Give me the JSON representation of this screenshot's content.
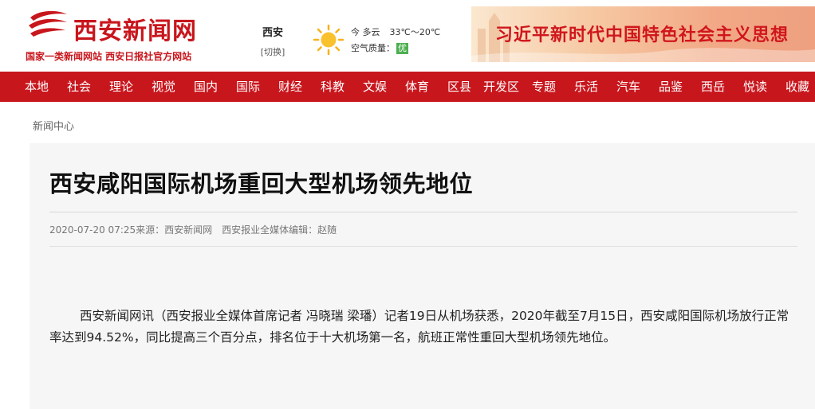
{
  "header": {
    "logo_text": "西安新闻网",
    "logo_tagline": "国家一类新闻网站 西安日报社官方网站",
    "city": "西安",
    "city_switch": "[切换]",
    "weather": {
      "icon": "sun-icon",
      "condition": "今 多云",
      "temperature": "33℃～20℃",
      "aqi_label": "空气质量：",
      "aqi_value": "优"
    },
    "banner_text": "习近平新时代中国特色社会主义思想"
  },
  "nav": {
    "items": [
      "本地",
      "社会",
      "理论",
      "视觉",
      "国内",
      "国际",
      "财经",
      "科教",
      "文娱",
      "体育",
      "区县",
      "开发区",
      "专题",
      "乐活",
      "汽车",
      "品鉴",
      "西岳",
      "悦读",
      "收藏"
    ]
  },
  "breadcrumb": "新闻中心",
  "article": {
    "title": "西安咸阳国际机场重回大型机场领先地位",
    "datetime": "2020-07-20 07:25",
    "source": "来源：西安新闻网",
    "editor": "西安报业全媒体编辑：赵随",
    "paragraph": "西安新闻网讯（西安报业全媒体首席记者 冯晓瑞 梁璠）记者19日从机场获悉，2020年截至7月15日，西安咸阳国际机场放行正常率达到94.52%，同比提高三个百分点，排名位于十大机场第一名，航班正常性重回大型机场领先地位。"
  },
  "colors": {
    "brand_red": "#c8161d",
    "article_bg": "#f6f6f6",
    "aqi_green": "#4caf50"
  }
}
